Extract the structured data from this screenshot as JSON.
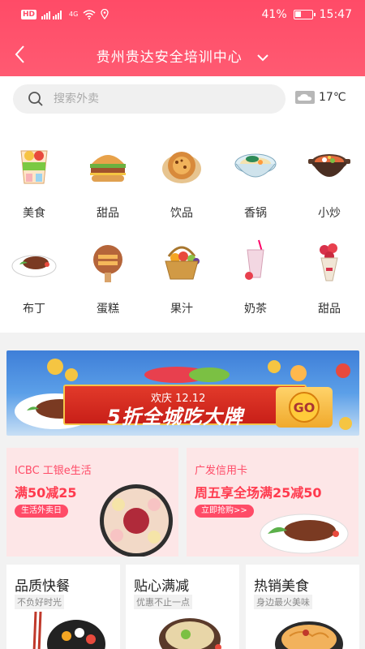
{
  "status": {
    "hd": "HD",
    "net": "4G",
    "battery": "41%",
    "battery_level": 0.41,
    "time": "15:47"
  },
  "nav": {
    "title": "贵州贵达安全培训中心"
  },
  "search": {
    "placeholder": "搜索外卖"
  },
  "weather": {
    "temp": "17℃",
    "icon": "cloud-icon"
  },
  "categories": [
    {
      "label": "美食",
      "icon": "food-drink-icon"
    },
    {
      "label": "甜品",
      "icon": "burger-icon"
    },
    {
      "label": "饮品",
      "icon": "pancake-icon"
    },
    {
      "label": "香锅",
      "icon": "noodle-bowl-icon"
    },
    {
      "label": "小炒",
      "icon": "stir-fry-pot-icon"
    },
    {
      "label": "布丁",
      "icon": "steak-plate-icon"
    },
    {
      "label": "蛋糕",
      "icon": "cake-icon"
    },
    {
      "label": "果汁",
      "icon": "fruit-basket-icon"
    },
    {
      "label": "奶茶",
      "icon": "milk-tea-icon"
    },
    {
      "label": "甜品",
      "icon": "bouquet-icon"
    }
  ],
  "banner": {
    "small": "欢庆 12.12",
    "big": "5折全城吃大牌",
    "go": "GO"
  },
  "promos": [
    {
      "title": "ICBC 工银e生活",
      "offer": "满50减25",
      "tag": "生活外卖日"
    },
    {
      "title": "广发信用卡",
      "offer": "周五享全场满25减50",
      "tag": "立即抢购>>"
    }
  ],
  "quick": [
    {
      "title": "品质快餐",
      "sub": "不负好时光"
    },
    {
      "title": "贴心满减",
      "sub": "优惠不止一点"
    },
    {
      "title": "热销美食",
      "sub": "身边最火美味"
    }
  ],
  "colors": {
    "brand": "#ff4b67",
    "promo_bg": "#fde6e7"
  }
}
